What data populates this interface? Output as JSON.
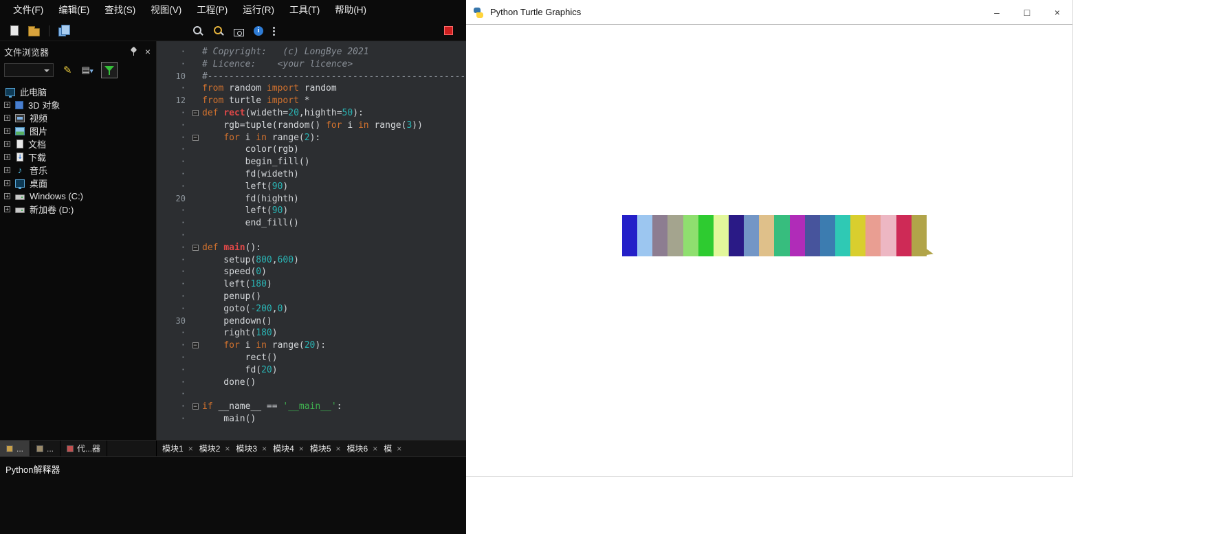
{
  "ide": {
    "menu": [
      "文件(F)",
      "编辑(E)",
      "查找(S)",
      "视图(V)",
      "工程(P)",
      "运行(R)",
      "工具(T)",
      "帮助(H)"
    ],
    "toolbar": {
      "icons": [
        {
          "name": "new-file-icon",
          "type": "page"
        },
        {
          "name": "open-file-icon",
          "type": "folder"
        },
        {
          "name": "sep1",
          "type": "sep"
        },
        {
          "name": "copy-icon",
          "type": "copy"
        },
        {
          "name": "spacer",
          "type": "space"
        },
        {
          "name": "search-icon",
          "type": "search"
        },
        {
          "name": "search-in-files-icon",
          "type": "search2"
        },
        {
          "name": "screenshot-icon",
          "type": "cam"
        },
        {
          "name": "about-icon",
          "type": "info"
        },
        {
          "name": "more-tools-icon",
          "type": "dots"
        }
      ],
      "stop": {
        "name": "stop-icon",
        "type": "stop"
      }
    },
    "file_browser": {
      "title": "文件浏览器",
      "tree": [
        {
          "label": "此电脑",
          "icon": "computer",
          "expander": false
        },
        {
          "label": "3D 对象",
          "icon": "cube",
          "expander": true
        },
        {
          "label": "视频",
          "icon": "film",
          "expander": true
        },
        {
          "label": "图片",
          "icon": "image",
          "expander": true
        },
        {
          "label": "文档",
          "icon": "doc",
          "expander": true
        },
        {
          "label": "下载",
          "icon": "download",
          "expander": true
        },
        {
          "label": "音乐",
          "icon": "music",
          "expander": true
        },
        {
          "label": "桌面",
          "icon": "desktop",
          "expander": true
        },
        {
          "label": "Windows (C:)",
          "icon": "drive",
          "expander": true
        },
        {
          "label": "新加卷 (D:)",
          "icon": "drive",
          "expander": true
        }
      ]
    },
    "editor": {
      "syntax_colors": {
        "comment": "#8a9098",
        "keyword": "#d2722e",
        "defname": "#e04848",
        "number": "#2ab5b5",
        "string": "#3fae4f",
        "plain": "#d4d7da",
        "background": "#2c2e31"
      },
      "lines": [
        {
          "g": "·",
          "f": 0,
          "t": [
            [
              "cm",
              "# Copyright:   (c) LongBye 2021"
            ]
          ]
        },
        {
          "g": "·",
          "f": 0,
          "t": [
            [
              "cm",
              "# Licence:    <your licence>"
            ]
          ]
        },
        {
          "g": "10",
          "f": 0,
          "t": [
            [
              "cm",
              "#-------------------------------------------------------------------------------"
            ]
          ]
        },
        {
          "g": "·",
          "f": 0,
          "t": [
            [
              "kw",
              "from"
            ],
            [
              "pl",
              " random "
            ],
            [
              "kw",
              "import"
            ],
            [
              "pl",
              " random"
            ]
          ]
        },
        {
          "g": "12",
          "f": 0,
          "t": [
            [
              "kw",
              "from"
            ],
            [
              "pl",
              " turtle "
            ],
            [
              "kw",
              "import"
            ],
            [
              "pl",
              " *"
            ]
          ]
        },
        {
          "g": "·",
          "f": 1,
          "t": [
            [
              "kw",
              "def"
            ],
            [
              "pl",
              " "
            ],
            [
              "fn",
              "rect"
            ],
            [
              "pl",
              "(wideth="
            ],
            [
              "num",
              "20"
            ],
            [
              "pl",
              ",highth="
            ],
            [
              "num",
              "50"
            ],
            [
              "pl",
              "):"
            ]
          ]
        },
        {
          "g": "·",
          "f": 0,
          "t": [
            [
              "pl",
              "    rgb=tuple(random() "
            ],
            [
              "kw",
              "for"
            ],
            [
              "pl",
              " i "
            ],
            [
              "kw",
              "in"
            ],
            [
              "pl",
              " range("
            ],
            [
              "num",
              "3"
            ],
            [
              "pl",
              "))"
            ]
          ]
        },
        {
          "g": "·",
          "f": 1,
          "t": [
            [
              "pl",
              "    "
            ],
            [
              "kw",
              "for"
            ],
            [
              "pl",
              " i "
            ],
            [
              "kw",
              "in"
            ],
            [
              "pl",
              " range("
            ],
            [
              "num",
              "2"
            ],
            [
              "pl",
              "):"
            ]
          ]
        },
        {
          "g": "·",
          "f": 0,
          "t": [
            [
              "pl",
              "        color(rgb)"
            ]
          ]
        },
        {
          "g": "·",
          "f": 0,
          "t": [
            [
              "pl",
              "        begin_fill()"
            ]
          ]
        },
        {
          "g": "·",
          "f": 0,
          "t": [
            [
              "pl",
              "        fd(wideth)"
            ]
          ]
        },
        {
          "g": "·",
          "f": 0,
          "t": [
            [
              "pl",
              "        left("
            ],
            [
              "num",
              "90"
            ],
            [
              "pl",
              ")"
            ]
          ]
        },
        {
          "g": "20",
          "f": 0,
          "t": [
            [
              "pl",
              "        fd(highth)"
            ]
          ]
        },
        {
          "g": "·",
          "f": 0,
          "t": [
            [
              "pl",
              "        left("
            ],
            [
              "num",
              "90"
            ],
            [
              "pl",
              ")"
            ]
          ]
        },
        {
          "g": "·",
          "f": 0,
          "t": [
            [
              "pl",
              "        end_fill()"
            ]
          ]
        },
        {
          "g": "·",
          "f": 0,
          "t": []
        },
        {
          "g": "·",
          "f": 1,
          "t": [
            [
              "kw",
              "def"
            ],
            [
              "pl",
              " "
            ],
            [
              "fn",
              "main"
            ],
            [
              "pl",
              "():"
            ]
          ]
        },
        {
          "g": "·",
          "f": 0,
          "t": [
            [
              "pl",
              "    setup("
            ],
            [
              "num",
              "800"
            ],
            [
              "pl",
              ","
            ],
            [
              "num",
              "600"
            ],
            [
              "pl",
              ")"
            ]
          ]
        },
        {
          "g": "·",
          "f": 0,
          "t": [
            [
              "pl",
              "    speed("
            ],
            [
              "num",
              "0"
            ],
            [
              "pl",
              ")"
            ]
          ]
        },
        {
          "g": "·",
          "f": 0,
          "t": [
            [
              "pl",
              "    left("
            ],
            [
              "num",
              "180"
            ],
            [
              "pl",
              ")"
            ]
          ]
        },
        {
          "g": "·",
          "f": 0,
          "t": [
            [
              "pl",
              "    penup()"
            ]
          ]
        },
        {
          "g": "·",
          "f": 0,
          "t": [
            [
              "pl",
              "    goto("
            ],
            [
              "num",
              "-200"
            ],
            [
              "pl",
              ","
            ],
            [
              "num",
              "0"
            ],
            [
              "pl",
              ")"
            ]
          ]
        },
        {
          "g": "30",
          "f": 0,
          "t": [
            [
              "pl",
              "    pendown()"
            ]
          ]
        },
        {
          "g": "·",
          "f": 0,
          "t": [
            [
              "pl",
              "    right("
            ],
            [
              "num",
              "180"
            ],
            [
              "pl",
              ")"
            ]
          ]
        },
        {
          "g": "·",
          "f": 1,
          "t": [
            [
              "pl",
              "    "
            ],
            [
              "kw",
              "for"
            ],
            [
              "pl",
              " i "
            ],
            [
              "kw",
              "in"
            ],
            [
              "pl",
              " range("
            ],
            [
              "num",
              "20"
            ],
            [
              "pl",
              "):"
            ]
          ]
        },
        {
          "g": "·",
          "f": 0,
          "t": [
            [
              "pl",
              "        rect()"
            ]
          ]
        },
        {
          "g": "·",
          "f": 0,
          "t": [
            [
              "pl",
              "        fd("
            ],
            [
              "num",
              "20"
            ],
            [
              "pl",
              ")"
            ]
          ]
        },
        {
          "g": "·",
          "f": 0,
          "t": [
            [
              "pl",
              "    done()"
            ]
          ]
        },
        {
          "g": "·",
          "f": 0,
          "t": []
        },
        {
          "g": "·",
          "f": 1,
          "t": [
            [
              "kw",
              "if"
            ],
            [
              "pl",
              " __name__ == "
            ],
            [
              "str",
              "'__main__'"
            ],
            [
              "pl",
              ":"
            ]
          ]
        },
        {
          "g": "·",
          "f": 0,
          "t": [
            [
              "pl",
              "    main()"
            ]
          ]
        }
      ]
    },
    "sidebar_tabs": [
      {
        "label": "...",
        "color": "#c8a04a"
      },
      {
        "label": "...",
        "color": "#9a8a6a"
      },
      {
        "label": "代...器",
        "color": "#c05050"
      }
    ],
    "module_tabs": [
      "模块1",
      "模块2",
      "模块3",
      "模块4",
      "模块5",
      "模块6",
      "模"
    ],
    "bottom_panel_title": "Python解释器"
  },
  "turtle_window": {
    "title": "Python Turtle Graphics",
    "window_icon": "python-turtle-icon",
    "controls": {
      "minimize": "–",
      "maximize": "□",
      "close": "×"
    },
    "canvas_bars": [
      "#2420c8",
      "#9cc6f0",
      "#8d7d91",
      "#a4a48e",
      "#8fdf6f",
      "#2ecb30",
      "#e2f79b",
      "#2a1a86",
      "#7396c6",
      "#dfc08a",
      "#37bd7e",
      "#b02cb8",
      "#47549c",
      "#3c7cb0",
      "#2fc9b4",
      "#d9ce2e",
      "#e99e92",
      "#edb7c3",
      "#ce2a56",
      "#b1a449"
    ],
    "turtle_cursor_color": "#b1a449"
  }
}
